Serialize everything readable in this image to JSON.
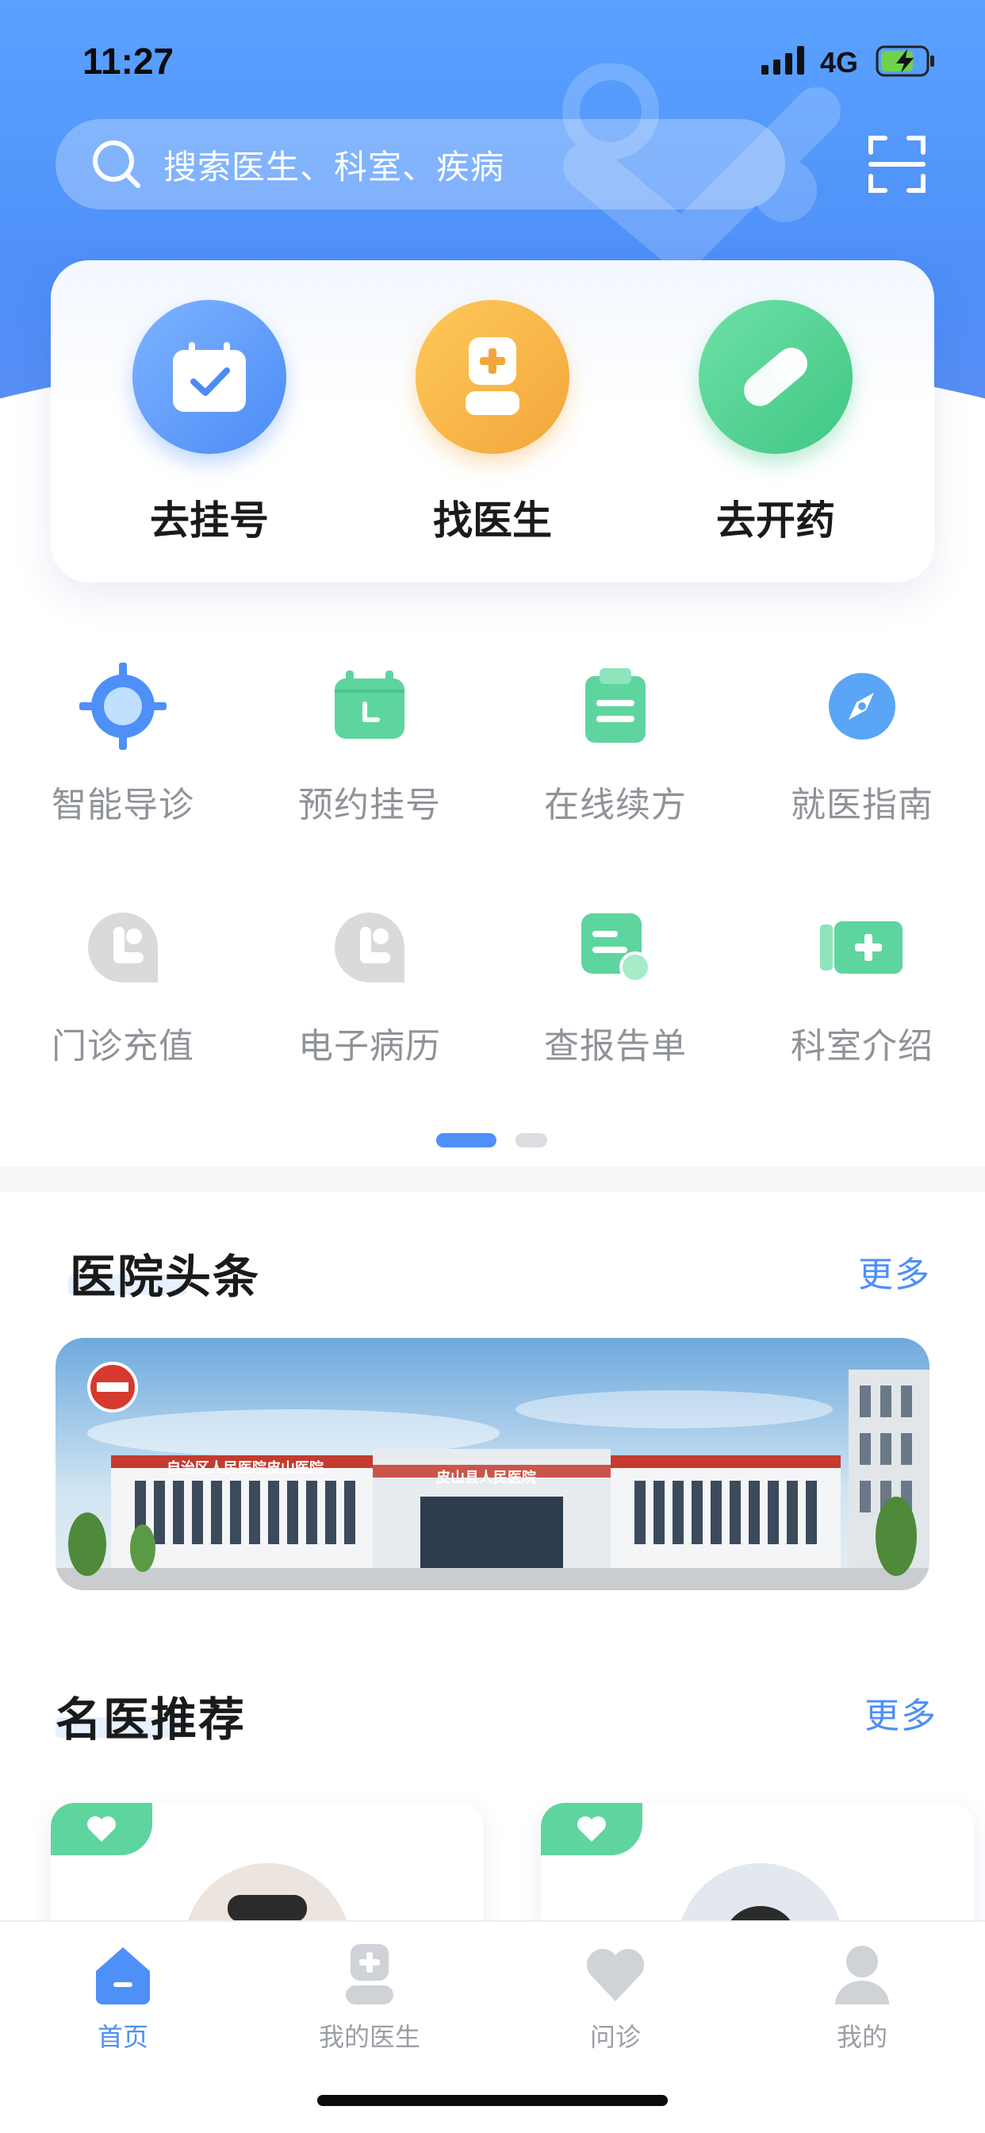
{
  "status": {
    "time": "11:27",
    "network": "4G"
  },
  "search": {
    "placeholder": "搜索医生、科室、疾病"
  },
  "main_actions": [
    {
      "label": "去挂号",
      "icon": "calendar-check-icon",
      "color": "#5d9cf9"
    },
    {
      "label": "找医生",
      "icon": "doctor-icon",
      "color": "#f5b23d"
    },
    {
      "label": "去开药",
      "icon": "pill-icon",
      "color": "#4fd08f"
    }
  ],
  "grid": [
    {
      "label": "智能导诊",
      "icon": "target-icon"
    },
    {
      "label": "预约挂号",
      "icon": "calendar-icon"
    },
    {
      "label": "在线续方",
      "icon": "clipboard-icon"
    },
    {
      "label": "就医指南",
      "icon": "compass-icon"
    },
    {
      "label": "门诊充值",
      "icon": "placeholder-icon"
    },
    {
      "label": "电子病历",
      "icon": "placeholder-icon"
    },
    {
      "label": "查报告单",
      "icon": "report-icon"
    },
    {
      "label": "科室介绍",
      "icon": "department-icon"
    }
  ],
  "pager": {
    "active": 1,
    "count": 2
  },
  "news": {
    "title": "医院头条",
    "more": "更多",
    "banner": {
      "sign_left": "自治区人民医院皮山医院",
      "sign_center": "皮山县人民医院"
    }
  },
  "doctors": {
    "title": "名医推荐",
    "more": "更多"
  },
  "tabs": [
    {
      "label": "首页",
      "icon": "home-icon",
      "active": true
    },
    {
      "label": "我的医生",
      "icon": "my-doctor-icon",
      "active": false
    },
    {
      "label": "问诊",
      "icon": "heart-icon",
      "active": false
    },
    {
      "label": "我的",
      "icon": "user-icon",
      "active": false
    }
  ],
  "colors": {
    "primary": "#4e8ff8",
    "green": "#5ed59e",
    "grey_text": "#8f9399"
  }
}
